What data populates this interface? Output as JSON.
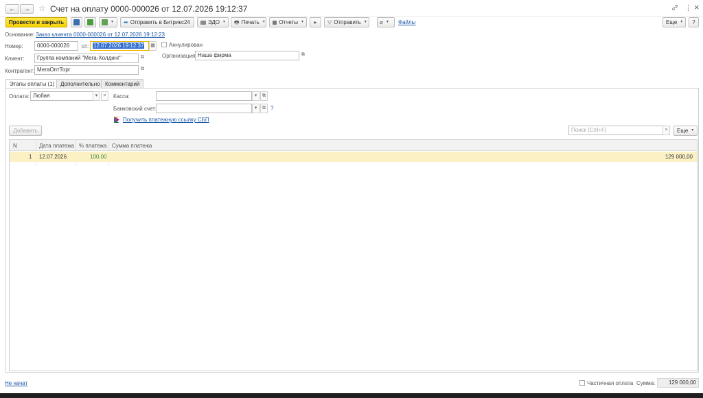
{
  "window": {
    "title": "Счет на оплату 0000-000026 от 12.07.2026 19:12:37",
    "back_label": "←",
    "forward_label": "→",
    "star": "☆",
    "link_glyph": "🔗",
    "menu_glyph": "⋮",
    "close_glyph": "×"
  },
  "toolbar": {
    "post_close": "Провести и закрыть",
    "send_bitrix": "Отправить в Битрикс24",
    "edo": "ЭДО",
    "print": "Печать",
    "reports": "Отчеты",
    "send": "Отправить",
    "files": "Файлы",
    "more": "Еще",
    "help": "?"
  },
  "header": {
    "basis_label": "Основание:",
    "basis_link": "Заказ клиента 0000-000026 от 12.07.2026 19:12:23",
    "number_label": "Номер:",
    "number_value": "0000-000026",
    "date_label": "от:",
    "date_value": "12.07.2026 19:12:37",
    "annulled_label": "Аннулирован",
    "client_label": "Клиент:",
    "client_value": "Группа компаний \"Мега-Холдинг\"",
    "org_label": "Организация:",
    "org_value": "Наша фирма",
    "contractor_label": "Контрагент:",
    "contractor_value": "МегаОптТорг"
  },
  "tabs": [
    {
      "label": "Этапы оплаты (1)"
    },
    {
      "label": "Дополнительно"
    },
    {
      "label": "Комментарий"
    }
  ],
  "payment": {
    "payment_label": "Оплата:",
    "payment_value": "Любая",
    "cash_label": "Касса:",
    "cash_value": "",
    "bank_label": "Банковский счет:",
    "bank_value": "",
    "sbp_link": "Получить платежную ссылку СБП",
    "add_button": "Добавить",
    "search_placeholder": "Поиск (Ctrl+F)",
    "more": "Еще"
  },
  "table": {
    "columns": [
      "N",
      "Дата платежа",
      "% платежа",
      "Сумма платежа"
    ],
    "rows": [
      {
        "n": "1",
        "date": "12.07.2026",
        "percent": "100,00",
        "sum": "129 000,00"
      }
    ]
  },
  "footer": {
    "status_link": "Не начат",
    "partial_label": "Частичная оплата",
    "sum_label": "Сумма:",
    "sum_value": "129 000,00"
  },
  "colors": {
    "accent_yellow": "#f5d200",
    "link_blue": "#1c58a6",
    "selected_row": "#fbf1c5",
    "percent_green": "#3b8a3b"
  }
}
